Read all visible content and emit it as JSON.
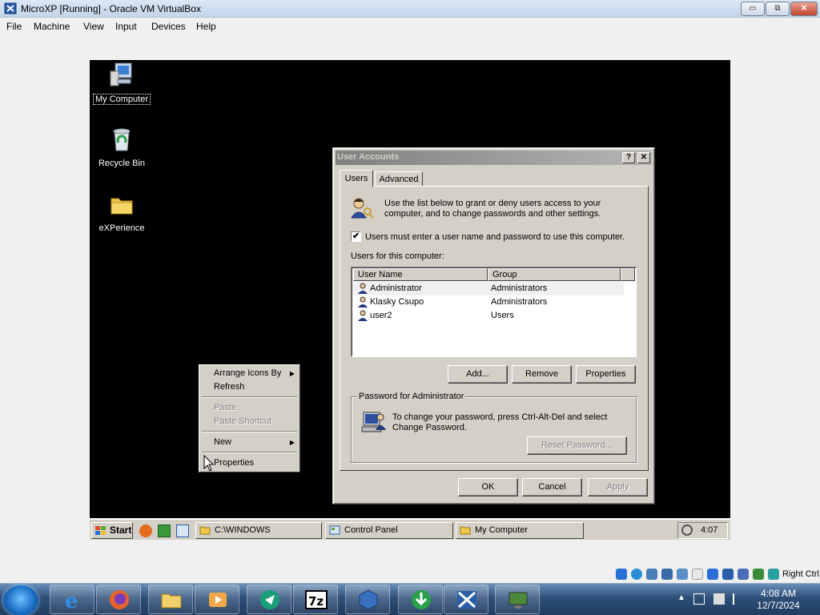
{
  "host_window": {
    "title": "MicroXP [Running] - Oracle VM VirtualBox",
    "controls": {
      "minimize": "▭",
      "restore": "⧉",
      "close": "✕"
    },
    "menu": [
      "File",
      "Machine",
      "View",
      "Input",
      "Devices",
      "Help"
    ]
  },
  "desktop": {
    "icons": [
      {
        "label": "My Computer",
        "selected": true
      },
      {
        "label": "Recycle Bin",
        "selected": false
      },
      {
        "label": "eXPerience",
        "selected": false
      }
    ]
  },
  "context_menu": {
    "arrange": "Arrange Icons By",
    "refresh": "Refresh",
    "paste": "Paste",
    "paste_shortcut": "Paste Shortcut",
    "new": "New",
    "properties": "Properties",
    "arrow": "▶"
  },
  "dialog": {
    "title": "User Accounts",
    "help": "?",
    "close": "✕",
    "tabs": {
      "users": "Users",
      "advanced": "Advanced"
    },
    "intro_line1": "Use the list below to grant or deny users access to your",
    "intro_line2": "computer, and to change passwords and other settings.",
    "checkbox_label": "Users must enter a user name and password to use this computer.",
    "checkbox_mark": "✔",
    "list_label": "Users for this computer:",
    "columns": {
      "user_name": "User Name",
      "group": "Group"
    },
    "users": [
      {
        "name": "Administrator",
        "group": "Administrators"
      },
      {
        "name": "Klasky Csupo",
        "group": "Administrators"
      },
      {
        "name": "user2",
        "group": "Users"
      }
    ],
    "buttons": {
      "add": "Add...",
      "remove": "Remove",
      "properties": "Properties"
    },
    "password_group": "Password for Administrator",
    "password_line1": "To change your password, press Ctrl-Alt-Del and select",
    "password_line2": "Change Password.",
    "reset_password": "Reset Password...",
    "ok": "OK",
    "cancel": "Cancel",
    "apply": "Apply"
  },
  "vm_taskbar": {
    "start": "Start",
    "tasks": [
      "C:\\WINDOWS",
      "Control Panel",
      "My Computer"
    ],
    "clock": "4:07"
  },
  "host_status": {
    "hostkey": "Right Ctrl"
  },
  "host_taskbar": {
    "time": "4:08 AM",
    "date": "12/7/2024"
  }
}
